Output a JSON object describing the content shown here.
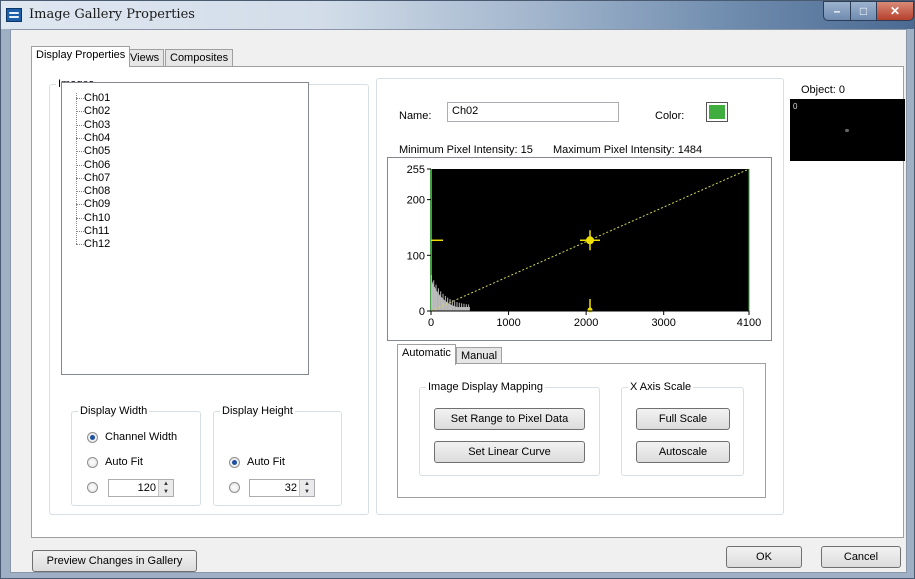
{
  "window": {
    "title": "Image Gallery Properties"
  },
  "tabs": [
    "Display Properties",
    "Views",
    "Composites"
  ],
  "images": {
    "legend": "Images",
    "items": [
      "Ch01",
      "Ch02",
      "Ch03",
      "Ch04",
      "Ch05",
      "Ch06",
      "Ch07",
      "Ch08",
      "Ch09",
      "Ch10",
      "Ch11",
      "Ch12"
    ]
  },
  "display_width": {
    "legend": "Display Width",
    "opt1": "Channel Width",
    "opt2": "Auto Fit",
    "value": "120",
    "selected": "Channel Width"
  },
  "display_height": {
    "legend": "Display Height",
    "opt1": "Auto Fit",
    "value": "32",
    "selected": "Auto Fit"
  },
  "properties": {
    "name_label": "Name:",
    "name_value": "Ch02",
    "color_label": "Color:",
    "color": "#3fae3f",
    "min_intensity": "Minimum Pixel Intensity: 15",
    "max_intensity": "Maximum Pixel Intensity: 1484"
  },
  "chart_data": {
    "type": "line",
    "x": [
      0,
      4100
    ],
    "y": [
      0,
      255
    ],
    "xlim": [
      0,
      4100
    ],
    "ylim": [
      0,
      255
    ],
    "x_ticks": [
      0,
      1000,
      2000,
      3000,
      4100
    ],
    "y_ticks": [
      0,
      100,
      200,
      255
    ],
    "control_point": {
      "x": 2050,
      "y": 127
    },
    "histogram_max_x": 500,
    "colors": {
      "plot_bg": "#000000",
      "curve": "#d6d65a",
      "marker": "#f0e000",
      "histogram": "#bdbdbd",
      "frame": "#3f9f3f"
    }
  },
  "mapping_tabs": [
    "Automatic",
    "Manual"
  ],
  "mapping": {
    "legend": "Image Display Mapping",
    "set_range": "Set Range to Pixel Data",
    "set_linear": "Set Linear Curve"
  },
  "xaxis": {
    "legend": "X Axis Scale",
    "full": "Full Scale",
    "auto": "Autoscale"
  },
  "object": {
    "label": "Object: 0",
    "preview_index": "0"
  },
  "footer": {
    "preview_btn": "Preview Changes in Gallery",
    "ok": "OK",
    "cancel": "Cancel"
  }
}
